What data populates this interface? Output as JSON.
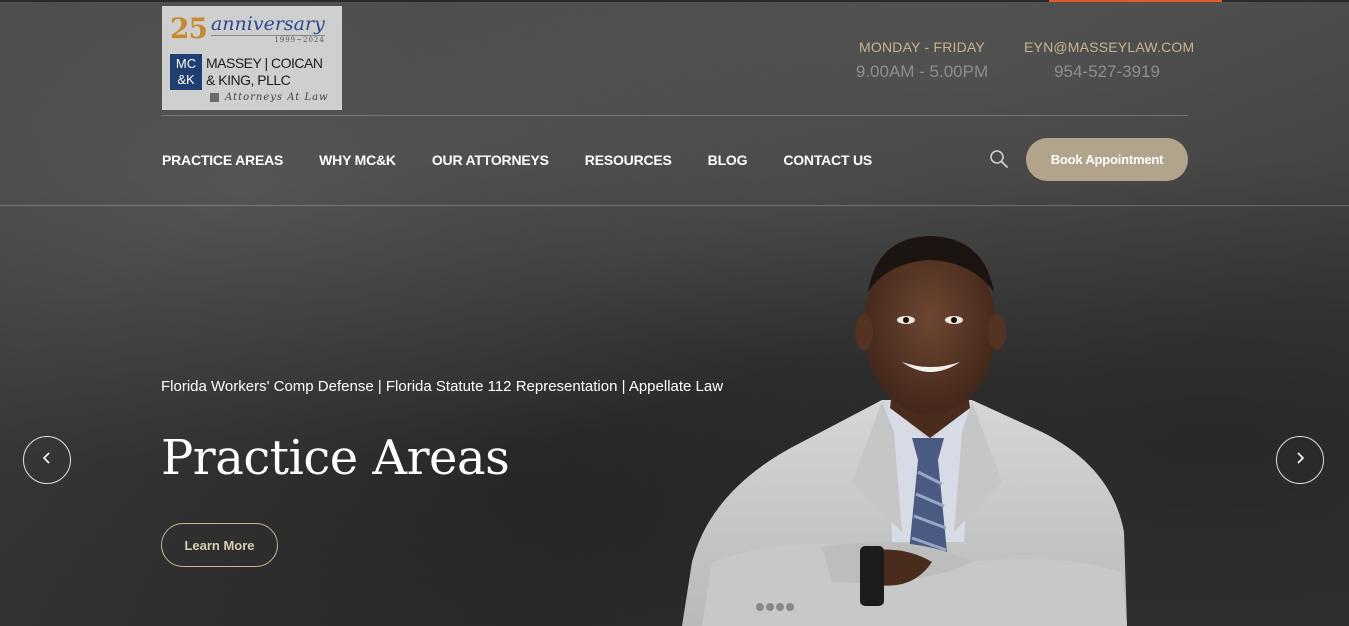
{
  "logo": {
    "number": "25",
    "anniversary_word": "anniversary",
    "years": "1999~2024",
    "mark_line1": "MC",
    "mark_line2": "&K",
    "firm_line1": "MASSEY | COICAN",
    "firm_line2": "& KING, PLLC",
    "tagline": "Attorneys At Law"
  },
  "contact": {
    "hours_label": "MONDAY - FRIDAY",
    "hours_value": "9.00AM - 5.00PM",
    "email_label": "EYN@MASSEYLAW.COM",
    "phone_value": "954-527-3919"
  },
  "nav": {
    "items": [
      {
        "label": "PRACTICE AREAS"
      },
      {
        "label": "WHY MC&K"
      },
      {
        "label": "OUR ATTORNEYS"
      },
      {
        "label": "RESOURCES"
      },
      {
        "label": "BLOG"
      },
      {
        "label": "CONTACT US"
      }
    ],
    "search_icon": "search-icon",
    "book_label": "Book Appointment"
  },
  "hero": {
    "subtitle": "Florida Workers' Comp Defense | Florida Statute 112 Representation | Appellate Law",
    "title": "Practice Areas",
    "cta_label": "Learn More",
    "prev_icon": "chevron-left-icon",
    "next_icon": "chevron-right-icon"
  },
  "colors": {
    "accent_tan": "#b1a48b",
    "label_gold": "#c9b58d",
    "top_accent": "#e05a2b",
    "logo_blue": "#1f3f72",
    "logo_gold": "#c8892c"
  }
}
